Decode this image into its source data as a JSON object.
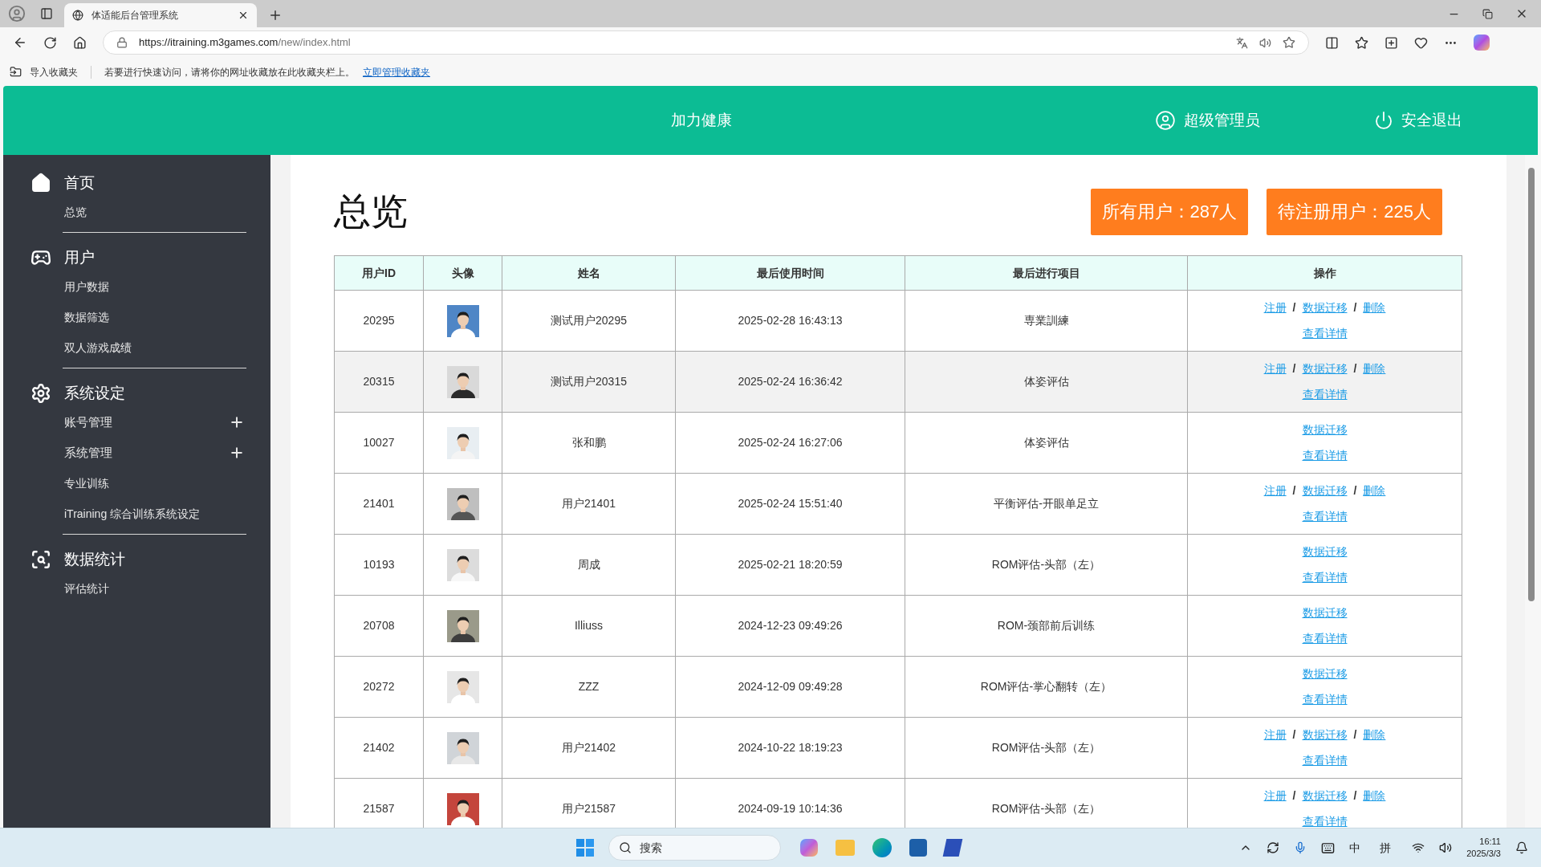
{
  "browser": {
    "tab": {
      "title": "体适能后台管理系统",
      "selected": true
    },
    "url": {
      "host": "https://itraining.m3games.com",
      "path": "/new/index.html"
    },
    "favorites_bar": {
      "import": "导入收藏夹",
      "hint": "若要进行快速访问，请将你的网址收藏放在此收藏夹栏上。",
      "link": "立即管理收藏夹"
    }
  },
  "header": {
    "brand": "加力健康",
    "user": "超级管理员",
    "logout": "安全退出"
  },
  "sidebar": {
    "sections": [
      {
        "title": "首页",
        "items": [
          {
            "kind": "link",
            "label": "总览"
          }
        ]
      },
      {
        "title": "用户",
        "items": [
          {
            "kind": "link",
            "label": "用户数据"
          },
          {
            "kind": "link",
            "label": "数据筛选"
          },
          {
            "kind": "link",
            "label": "双人游戏成绩"
          }
        ]
      },
      {
        "title": "系统设定",
        "items": [
          {
            "kind": "group",
            "label": "账号管理",
            "expanded": false
          },
          {
            "kind": "group",
            "label": "系统管理",
            "expanded": false
          },
          {
            "kind": "link",
            "label": "专业训练"
          },
          {
            "kind": "link",
            "label": "iTraining 综合训练系统设定"
          }
        ]
      },
      {
        "title": "数据统计",
        "items": [
          {
            "kind": "link",
            "label": "评估统计"
          }
        ]
      }
    ]
  },
  "page": {
    "title": "总览",
    "stats": [
      "所有用户：287人",
      "待注册用户：225人"
    ]
  },
  "table": {
    "columns": [
      "用户ID",
      "头像",
      "姓名",
      "最后使用时间",
      "最后进行项目",
      "操作"
    ],
    "rows": [
      {
        "id": "20295",
        "name": "测试用户20295",
        "time": "2025-02-28 16:43:13",
        "project": "専業訓練",
        "selected": false,
        "actions": [
          [
            {
              "kind": "link",
              "text": "注册"
            },
            {
              "kind": "separator",
              "text": "/"
            },
            {
              "kind": "link",
              "text": "数据迁移"
            },
            {
              "kind": "separator",
              "text": "/"
            },
            {
              "kind": "link",
              "text": "删除"
            }
          ],
          [
            {
              "kind": "link",
              "text": "查看详情"
            }
          ]
        ]
      },
      {
        "id": "20315",
        "name": "测试用户20315",
        "time": "2025-02-24 16:36:42",
        "project": "体姿评估",
        "selected": true,
        "actions": [
          [
            {
              "kind": "link",
              "text": "注册"
            },
            {
              "kind": "separator",
              "text": "/"
            },
            {
              "kind": "link",
              "text": "数据迁移"
            },
            {
              "kind": "separator",
              "text": "/"
            },
            {
              "kind": "link",
              "text": "删除"
            }
          ],
          [
            {
              "kind": "link",
              "text": "查看详情"
            }
          ]
        ]
      },
      {
        "id": "10027",
        "name": "张和鹏",
        "time": "2025-02-24 16:27:06",
        "project": "体姿评估",
        "selected": false,
        "actions": [
          [
            {
              "kind": "link",
              "text": "数据迁移"
            }
          ],
          [
            {
              "kind": "link",
              "text": "查看详情"
            }
          ]
        ]
      },
      {
        "id": "21401",
        "name": "用户21401",
        "time": "2025-02-24 15:51:40",
        "project": "平衡评估-开眼单足立",
        "selected": false,
        "actions": [
          [
            {
              "kind": "link",
              "text": "注册"
            },
            {
              "kind": "separator",
              "text": "/"
            },
            {
              "kind": "link",
              "text": "数据迁移"
            },
            {
              "kind": "separator",
              "text": "/"
            },
            {
              "kind": "link",
              "text": "删除"
            }
          ],
          [
            {
              "kind": "link",
              "text": "查看详情"
            }
          ]
        ]
      },
      {
        "id": "10193",
        "name": "周成",
        "time": "2025-02-21 18:20:59",
        "project": "ROM评估-头部（左）",
        "selected": false,
        "actions": [
          [
            {
              "kind": "link",
              "text": "数据迁移"
            }
          ],
          [
            {
              "kind": "link",
              "text": "查看详情"
            }
          ]
        ]
      },
      {
        "id": "20708",
        "name": "Illiuss",
        "time": "2024-12-23 09:49:26",
        "project": "ROM-颈部前后训练",
        "selected": false,
        "actions": [
          [
            {
              "kind": "link",
              "text": "数据迁移"
            }
          ],
          [
            {
              "kind": "link",
              "text": "查看详情"
            }
          ]
        ]
      },
      {
        "id": "20272",
        "name": "ZZZ",
        "time": "2024-12-09 09:49:28",
        "project": "ROM评估-掌心翻转（左）",
        "selected": false,
        "actions": [
          [
            {
              "kind": "link",
              "text": "数据迁移"
            }
          ],
          [
            {
              "kind": "link",
              "text": "查看详情"
            }
          ]
        ]
      },
      {
        "id": "21402",
        "name": "用户21402",
        "time": "2024-10-22 18:19:23",
        "project": "ROM评估-头部（左）",
        "selected": false,
        "actions": [
          [
            {
              "kind": "link",
              "text": "注册"
            },
            {
              "kind": "separator",
              "text": "/"
            },
            {
              "kind": "link",
              "text": "数据迁移"
            },
            {
              "kind": "separator",
              "text": "/"
            },
            {
              "kind": "link",
              "text": "删除"
            }
          ],
          [
            {
              "kind": "link",
              "text": "查看详情"
            }
          ]
        ]
      },
      {
        "id": "21587",
        "name": "用户21587",
        "time": "2024-09-19 10:14:36",
        "project": "ROM评估-头部（左）",
        "selected": false,
        "actions": [
          [
            {
              "kind": "link",
              "text": "注册"
            },
            {
              "kind": "separator",
              "text": "/"
            },
            {
              "kind": "link",
              "text": "数据迁移"
            },
            {
              "kind": "separator",
              "text": "/"
            },
            {
              "kind": "link",
              "text": "删除"
            }
          ],
          [
            {
              "kind": "link",
              "text": "查看详情"
            }
          ]
        ]
      }
    ]
  },
  "taskbar": {
    "search": {
      "placeholder": "搜索"
    },
    "tray": {
      "ime_mode": "中",
      "ime": "拼",
      "time": "16:11",
      "date": "2025/3/3"
    }
  }
}
